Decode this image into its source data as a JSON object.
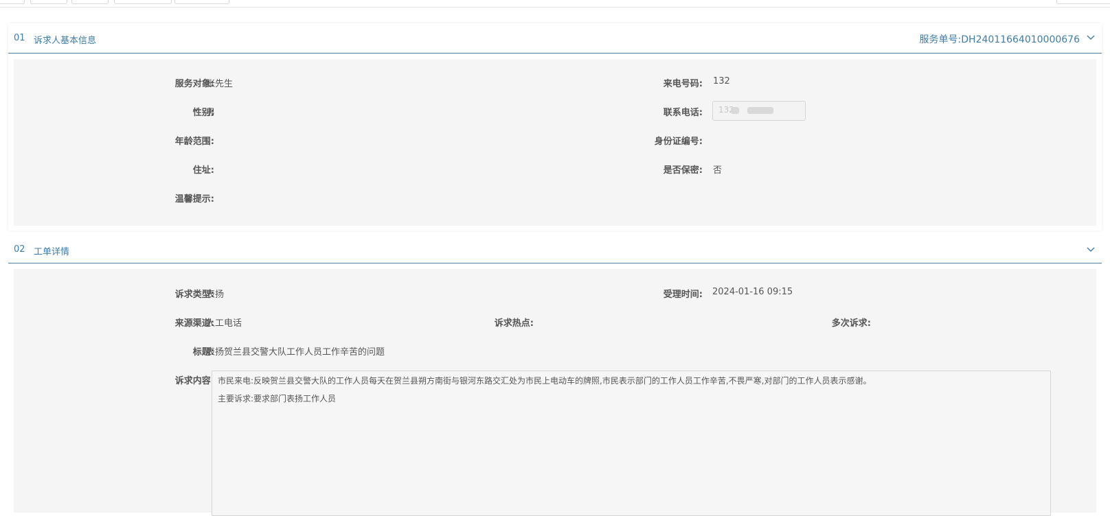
{
  "section1": {
    "number": "01",
    "title": "诉求人基本信息",
    "service_no_label": "服务单号:",
    "service_no": "DH24011664010000676",
    "fields": {
      "service_target_label": "服务对象:",
      "service_target": "张先生",
      "caller_no_label": "来电号码:",
      "caller_no": "132",
      "gender_label": "性别:",
      "gender": "男",
      "contact_phone_label": "联系电话:",
      "contact_phone": "132",
      "age_range_label": "年龄范围:",
      "age_range": "",
      "id_no_label": "身份证编号:",
      "id_no": "",
      "address_label": "住址:",
      "address": "",
      "confidential_label": "是否保密:",
      "confidential": "否",
      "tip_label": "温馨提示:",
      "tip": ""
    }
  },
  "section2": {
    "number": "02",
    "title": "工单详情",
    "fields": {
      "type_label": "诉求类型:",
      "type": "表扬",
      "accept_time_label": "受理时间:",
      "accept_time": "2024-01-16 09:15",
      "channel_label": "来源渠道:",
      "channel": "人工电话",
      "hotspot_label": "诉求热点:",
      "hotspot": "",
      "repeat_label": "多次诉求:",
      "repeat": "",
      "subject_label": "标题:",
      "subject": "表扬贺兰县交警大队工作人员工作辛苦的问题",
      "content_label": "诉求内容:",
      "content_line1": "市民来电:反映贺兰县交警大队的工作人员每天在贺兰县朔方南街与银河东路交汇处为市民上电动车的牌照,市民表示部门的工作人员工作辛苦,不畏严寒,对部门的工作人员表示感谢。",
      "content_line2": "主要诉求:要求部门表扬工作人员"
    }
  },
  "colors": {
    "accent": "#3d7dac",
    "divider": "#4d7fa3",
    "body_bg": "#f5f5f5"
  }
}
